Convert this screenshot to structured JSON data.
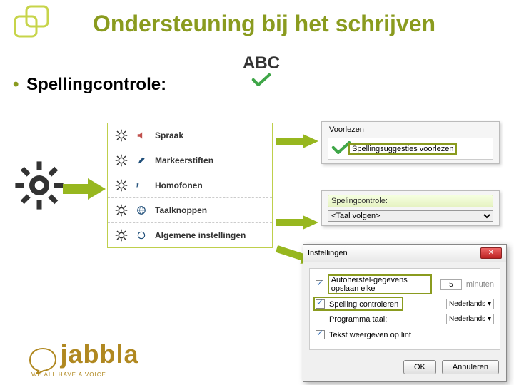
{
  "title": "Ondersteuning bij het schrijven",
  "subtitle": "Spellingcontrole:",
  "abc_label": "ABC",
  "settings_items": [
    {
      "label": "Spraak"
    },
    {
      "label": "Markeerstiften"
    },
    {
      "label": "Homofonen"
    },
    {
      "label": "Taalknoppen"
    },
    {
      "label": "Algemene instellingen"
    }
  ],
  "panel1": {
    "header": "Voorlezen",
    "checkbox_label": "Spellingsuggesties voorlezen"
  },
  "panel2": {
    "label": "Spelingcontrole:",
    "selected": "<Taal volgen>"
  },
  "panel3": {
    "title": "Instellingen",
    "row_autosave": "Autoherstel-gegevens opslaan elke",
    "autosave_value": "5",
    "autosave_unit": "minuten",
    "row_spellcheck": "Spelling controleren",
    "spellcheck_lang": "Nederlands",
    "row_programlang_label": "Programma taal:",
    "program_lang": "Nederlands",
    "row_showtext": "Tekst weergeven op lint",
    "ok": "OK",
    "cancel": "Annuleren"
  },
  "logo": {
    "brand": "jabbla",
    "tagline": "WE ALL HAVE A VOICE"
  }
}
